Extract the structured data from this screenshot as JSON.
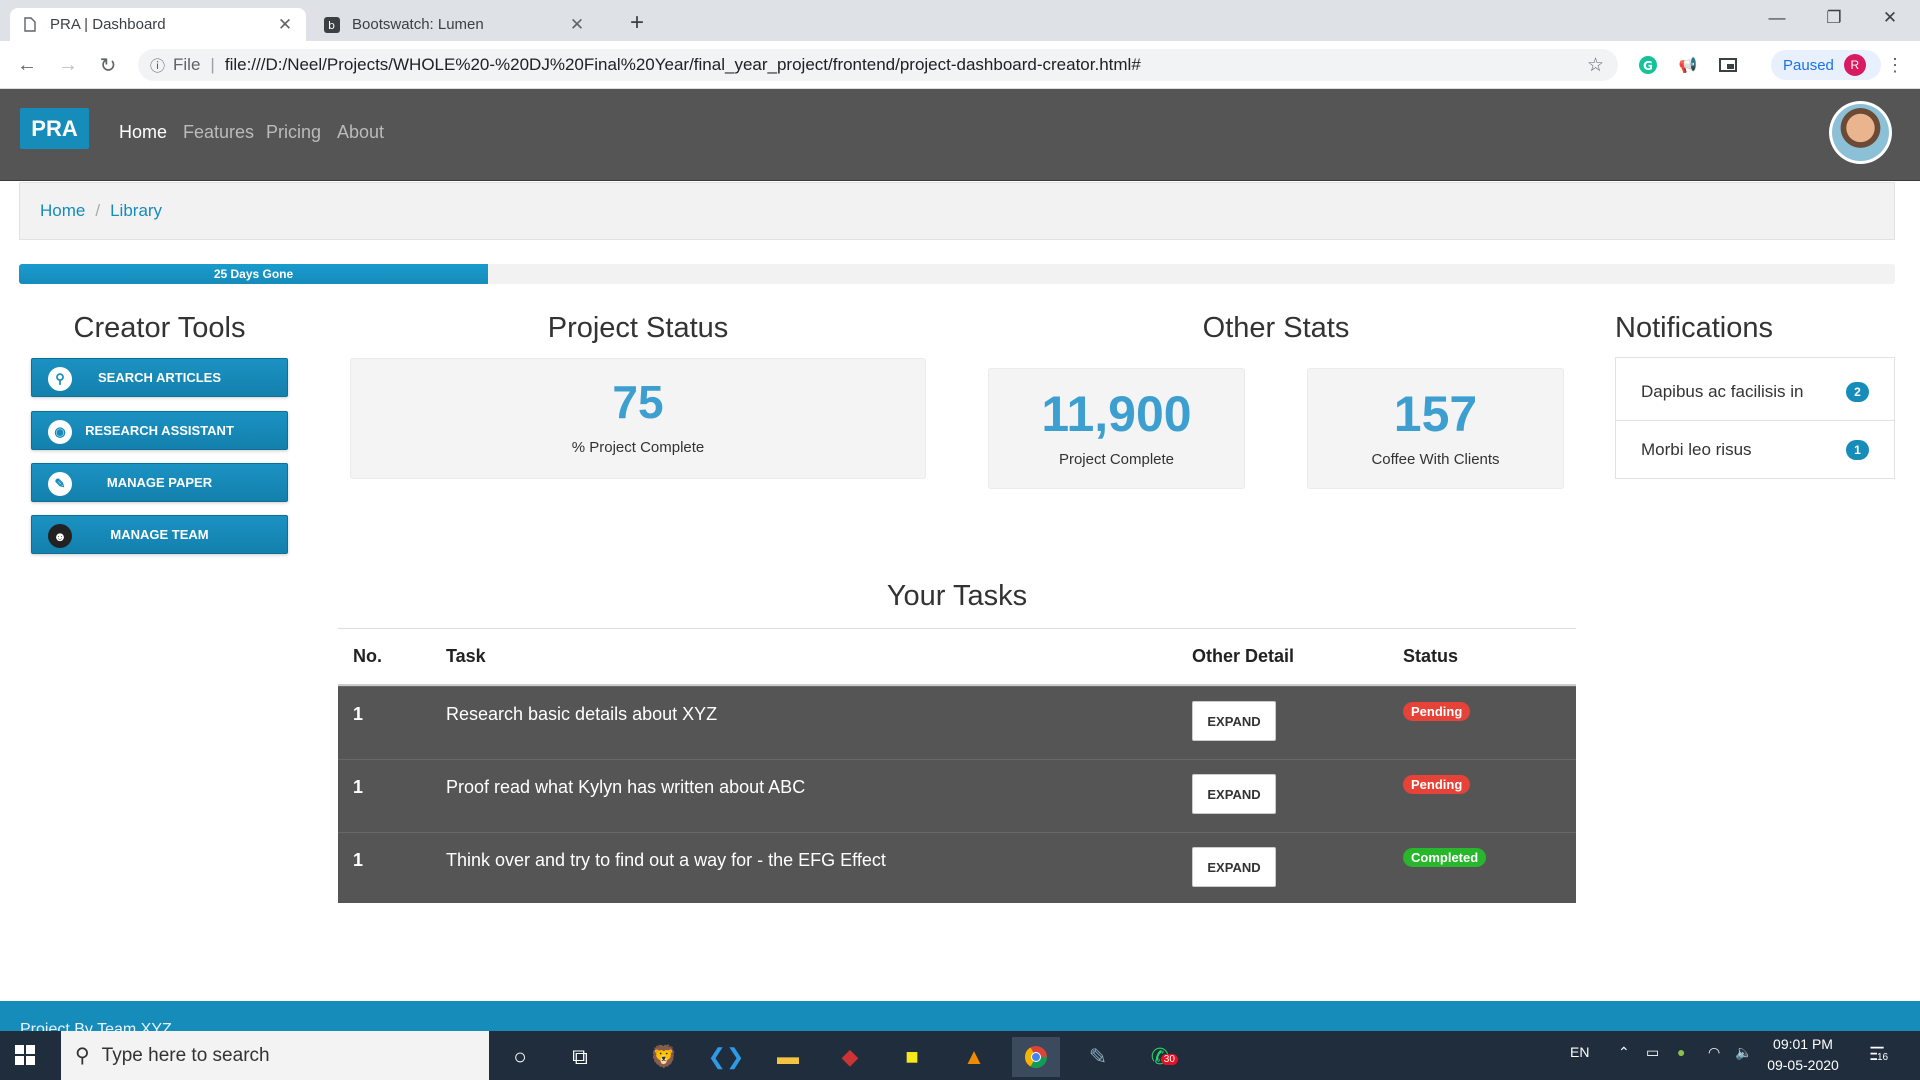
{
  "browser": {
    "tabs": [
      {
        "title": "PRA | Dashboard",
        "active": true
      },
      {
        "title": "Bootswatch: Lumen",
        "active": false
      }
    ],
    "url_scheme": "File",
    "url": "file:///D:/Neel/Projects/WHOLE%20-%20DJ%20Final%20Year/final_year_project/frontend/project-dashboard-creator.html#",
    "profile_status": "Paused",
    "profile_initial": "R"
  },
  "navbar": {
    "brand": "PRA",
    "links": [
      "Home",
      "Features",
      "Pricing",
      "About"
    ]
  },
  "breadcrumb": [
    "Home",
    "Library"
  ],
  "progress": {
    "label": "25 Days Gone",
    "fraction": 0.25
  },
  "creator_tools": {
    "title": "Creator Tools",
    "buttons": [
      "SEARCH ARTICLES",
      "RESEARCH ASSISTANT",
      "MANAGE PAPER",
      "MANAGE TEAM"
    ]
  },
  "project_status": {
    "title": "Project Status",
    "value": "75",
    "label": "% Project Complete"
  },
  "other_stats": {
    "title": "Other Stats",
    "cards": [
      {
        "value": "11,900",
        "label": "Project Complete"
      },
      {
        "value": "157",
        "label": "Coffee With Clients"
      }
    ]
  },
  "notifications": {
    "title": "Notifications",
    "items": [
      {
        "text": "Dapibus ac facilisis in",
        "count": "2"
      },
      {
        "text": "Morbi leo risus",
        "count": "1"
      }
    ]
  },
  "tasks": {
    "title": "Your Tasks",
    "headers": [
      "No.",
      "Task",
      "Other Detail",
      "Status"
    ],
    "expand_label": "EXPAND",
    "rows": [
      {
        "no": "1",
        "task": "Research basic details about XYZ",
        "status": "Pending",
        "status_color": "#e64237"
      },
      {
        "no": "1",
        "task": "Proof read what Kylyn has written about ABC",
        "status": "Pending",
        "status_color": "#e64237"
      },
      {
        "no": "1",
        "task": "Think over and try to find out a way for - the EFG Effect",
        "status": "Completed",
        "status_color": "#28b62c"
      }
    ]
  },
  "footer": {
    "text": "Project By Team XYZ"
  },
  "taskbar": {
    "search_placeholder": "Type here to search",
    "language": "EN",
    "time": "09:01 PM",
    "date": "09-05-2020",
    "whatsapp_badge": "30",
    "notification_count": "16"
  },
  "colors": {
    "primary": "#158cba",
    "navbar": "#555555",
    "pending": "#e64237",
    "completed": "#28b62c"
  }
}
